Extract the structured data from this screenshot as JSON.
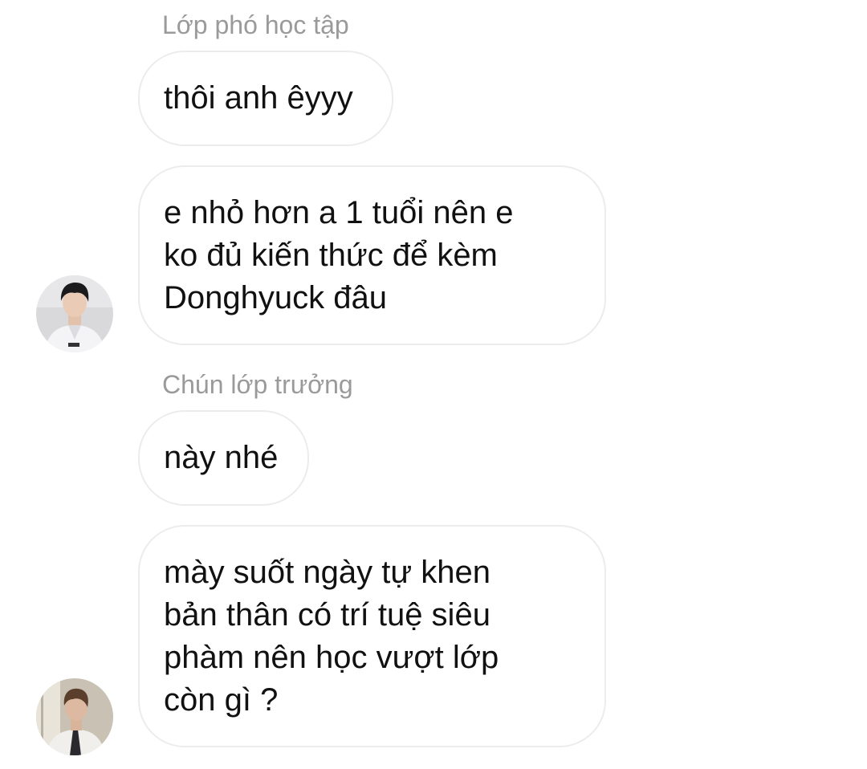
{
  "conversation": {
    "groups": [
      {
        "sender": "Lớp phó học tập",
        "avatar_icon": "person-avatar-icon",
        "messages": [
          {
            "lines": [
              "thôi anh êyyy"
            ]
          },
          {
            "lines": [
              "e nhỏ hơn a 1 tuổi nên e",
              "ko đủ kiến thức để kèm",
              "Donghyuck đâu"
            ]
          }
        ]
      },
      {
        "sender": "Chún lớp trưởng",
        "avatar_icon": "person-avatar-icon",
        "messages": [
          {
            "lines": [
              "này nhé"
            ]
          },
          {
            "lines": [
              "mày suốt ngày tự khen",
              "bản thân có trí tuệ siêu",
              "phàm nên học vượt lớp",
              "còn gì ?"
            ]
          }
        ]
      }
    ]
  }
}
